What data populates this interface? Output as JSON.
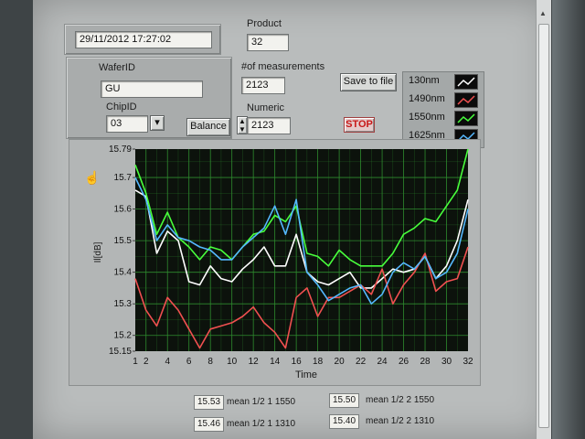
{
  "datetime": "29/11/2012 17:27:02",
  "product": {
    "label": "Product",
    "value": "32"
  },
  "wafer": {
    "label": "WaferID",
    "value": "GU"
  },
  "chip": {
    "label": "ChipID",
    "value": "03"
  },
  "balance_label": "Balance",
  "measurements": {
    "label": "#of measurements",
    "value": "2123"
  },
  "save_label": "Save to file",
  "numeric": {
    "label": "Numeric",
    "value": "2123"
  },
  "stop_label": "STOP",
  "stepper_icon": "up-down-arrows",
  "dropdown_icon": "chevron-down",
  "colors": {
    "plot_bg": "#0c120c",
    "grid": "#2e8b2e"
  },
  "legend": [
    {
      "name": "130nm",
      "color": "#ffffff"
    },
    {
      "name": "1490nm",
      "color": "#f05050"
    },
    {
      "name": "1550nm",
      "color": "#48ff3c"
    },
    {
      "name": "1625nm",
      "color": "#55b8ff"
    }
  ],
  "chart_data": {
    "type": "line",
    "xlabel": "Time",
    "ylabel": "Il[dB]",
    "xlim": [
      1,
      32
    ],
    "ylim": [
      15.15,
      15.79
    ],
    "xticks": [
      "1",
      "2",
      "4",
      "6",
      "8",
      "10",
      "12",
      "14",
      "16",
      "18",
      "20",
      "22",
      "24",
      "26",
      "28",
      "30",
      "32"
    ],
    "yticks": [
      "15.79",
      "15.7",
      "15.6",
      "15.5",
      "15.4",
      "15.3",
      "15.2",
      "15.15"
    ],
    "grid": true,
    "x": [
      1,
      2,
      3,
      4,
      5,
      6,
      7,
      8,
      9,
      10,
      11,
      12,
      13,
      14,
      15,
      16,
      17,
      18,
      19,
      20,
      21,
      22,
      23,
      24,
      25,
      26,
      27,
      28,
      29,
      30,
      31,
      32
    ],
    "series": [
      {
        "name": "130nm",
        "color": "#ffffff",
        "values": [
          15.66,
          15.64,
          15.46,
          15.53,
          15.5,
          15.37,
          15.36,
          15.42,
          15.38,
          15.37,
          15.41,
          15.44,
          15.48,
          15.42,
          15.42,
          15.52,
          15.4,
          15.37,
          15.36,
          15.38,
          15.4,
          15.35,
          15.35,
          15.38,
          15.41,
          15.4,
          15.41,
          15.45,
          15.38,
          15.42,
          15.5,
          15.63
        ]
      },
      {
        "name": "1490nm",
        "color": "#f05050",
        "values": [
          15.38,
          15.28,
          15.23,
          15.32,
          15.28,
          15.22,
          15.16,
          15.22,
          15.23,
          15.24,
          15.26,
          15.29,
          15.24,
          15.21,
          15.16,
          15.32,
          15.35,
          15.26,
          15.32,
          15.32,
          15.34,
          15.36,
          15.33,
          15.41,
          15.3,
          15.36,
          15.4,
          15.46,
          15.34,
          15.37,
          15.38,
          15.48
        ]
      },
      {
        "name": "1550nm",
        "color": "#48ff3c",
        "values": [
          15.74,
          15.65,
          15.52,
          15.59,
          15.51,
          15.48,
          15.44,
          15.48,
          15.47,
          15.44,
          15.48,
          15.52,
          15.53,
          15.58,
          15.56,
          15.61,
          15.46,
          15.45,
          15.42,
          15.47,
          15.44,
          15.42,
          15.42,
          15.42,
          15.46,
          15.52,
          15.54,
          15.57,
          15.56,
          15.61,
          15.66,
          15.79
        ]
      },
      {
        "name": "1625nm",
        "color": "#55b8ff",
        "values": [
          15.7,
          15.63,
          15.5,
          15.55,
          15.51,
          15.5,
          15.48,
          15.47,
          15.44,
          15.44,
          15.48,
          15.51,
          15.54,
          15.61,
          15.52,
          15.63,
          15.4,
          15.36,
          15.31,
          15.33,
          15.35,
          15.36,
          15.3,
          15.33,
          15.4,
          15.43,
          15.41,
          15.45,
          15.38,
          15.4,
          15.46,
          15.6
        ]
      }
    ]
  },
  "gauges": [
    {
      "value": "15.53",
      "label": "mean 1/2 1 1550"
    },
    {
      "value": "15.50",
      "label": "mean 1/2 2 1550"
    },
    {
      "value": "15.46",
      "label": "mean 1/2 1 1310"
    },
    {
      "value": "15.40",
      "label": "mean 1/2 2 1310"
    }
  ]
}
